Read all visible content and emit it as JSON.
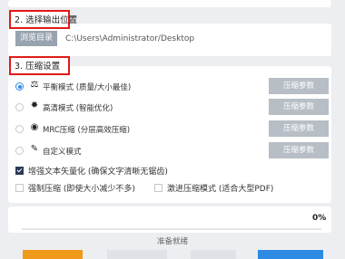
{
  "output": {
    "section_label": "2. 选择输出位置",
    "browse_label": "浏览目录",
    "path": "C:\\Users\\Administrator/Desktop"
  },
  "compress": {
    "section_label": "3. 压缩设置",
    "param_label": "压缩参数",
    "modes": [
      {
        "label": "平衡模式 (质量/大小最佳)",
        "icon": "balance-icon",
        "selected": true
      },
      {
        "label": "高清模式 (智能优化)",
        "icon": "sparkle-icon",
        "selected": false
      },
      {
        "label": "MRC压缩 (分层高效压缩)",
        "icon": "layers-icon",
        "selected": false
      },
      {
        "label": "自定义模式",
        "icon": "pen-icon",
        "selected": false
      }
    ],
    "options": [
      {
        "label": "增强文本矢量化 (确保文字清晰无锯齿)",
        "checked": true
      },
      {
        "label": "强制压缩 (即使大小减少不多)",
        "checked": false
      },
      {
        "label": "激进压缩模式 (适合大型PDF)",
        "checked": false
      }
    ]
  },
  "progress": {
    "percent_text": "0%",
    "value": 0,
    "status": "准备就绪"
  },
  "colors": {
    "accent": "#2f8ae3",
    "highlight": "#e01a1a",
    "muted_button": "#b7bec6",
    "browse_button": "#97a3af",
    "orange_button": "#f09a1a"
  }
}
